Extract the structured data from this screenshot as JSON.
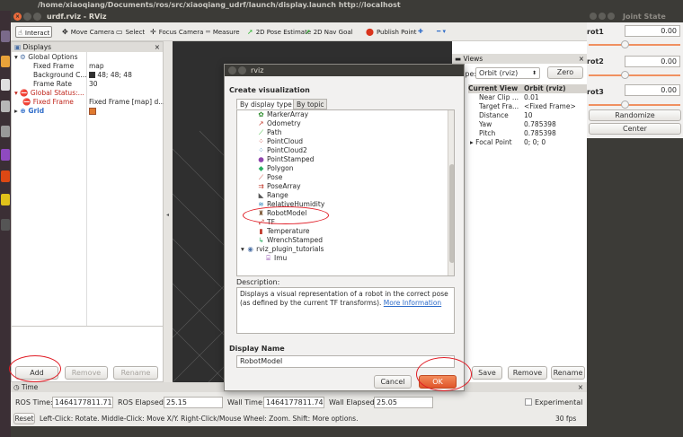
{
  "top_bar": {
    "title": "/home/xiaoqiang/Documents/ros/src/xiaoqiang_udrf/launch/display.launch http://localhost"
  },
  "rviz": {
    "title": "urdf.rviz - RViz",
    "toolbar": [
      {
        "label": "Interact",
        "icon": "hand-icon"
      },
      {
        "label": "Move Camera",
        "icon": "move-icon"
      },
      {
        "label": "Select",
        "icon": "select-icon"
      },
      {
        "label": "Focus Camera",
        "icon": "focus-icon"
      },
      {
        "label": "Measure",
        "icon": "ruler-icon"
      },
      {
        "label": "2D Pose Estimate",
        "icon": "arrow-green-icon"
      },
      {
        "label": "2D Nav Goal",
        "icon": "arrow-green-icon"
      },
      {
        "label": "Publish Point",
        "icon": "pin-icon"
      }
    ],
    "displays": {
      "title": "Displays",
      "rows": [
        {
          "name": "Global Options",
          "value": ""
        },
        {
          "name": "Fixed Frame",
          "value": "map"
        },
        {
          "name": "Background C...",
          "value": "48; 48; 48"
        },
        {
          "name": "Frame Rate",
          "value": "30"
        },
        {
          "name": "Global Status:...",
          "value": ""
        },
        {
          "name": "Fixed Frame",
          "value": "Fixed Frame [map] d..."
        },
        {
          "name": "Grid",
          "value": ""
        }
      ],
      "buttons": {
        "add": "Add",
        "remove": "Remove",
        "rename": "Rename"
      }
    },
    "views": {
      "title": "Views",
      "type_label": "Type:",
      "type_value": "Orbit (rviz)",
      "zero": "Zero",
      "header": [
        "Current View",
        "Orbit (rviz)"
      ],
      "rows": [
        {
          "k": "Near Clip ...",
          "v": "0.01"
        },
        {
          "k": "Target Fra...",
          "v": "<Fixed Frame>"
        },
        {
          "k": "Distance",
          "v": "10"
        },
        {
          "k": "Yaw",
          "v": "0.785398"
        },
        {
          "k": "Pitch",
          "v": "0.785398"
        },
        {
          "k": "Focal Point",
          "v": "0; 0; 0"
        }
      ],
      "buttons": {
        "save": "Save",
        "remove": "Remove",
        "rename": "Rename"
      }
    },
    "time": {
      "title": "Time",
      "ros_time_label": "ROS Time:",
      "ros_time": "1464177811.71",
      "ros_elapsed_label": "ROS Elapsed:",
      "ros_elapsed": "25.15",
      "wall_time_label": "Wall Time:",
      "wall_time": "1464177811.74",
      "wall_elapsed_label": "Wall Elapsed:",
      "wall_elapsed": "25.05",
      "experimental": "Experimental"
    },
    "status": {
      "reset": "Reset",
      "text": "Left-Click: Rotate. Middle-Click: Move X/Y. Right-Click/Mouse Wheel: Zoom. Shift: More options.",
      "fps": "30 fps"
    }
  },
  "dialog": {
    "title": "rviz",
    "heading": "Create visualization",
    "tabs": [
      "By display type",
      "By topic"
    ],
    "items": [
      {
        "label": "MarkerArray",
        "icon": "marker-icon",
        "color": "#2b8a2b"
      },
      {
        "label": "Odometry",
        "icon": "odometry-icon",
        "color": "#c0392b"
      },
      {
        "label": "Path",
        "icon": "path-icon",
        "color": "#2bb52b"
      },
      {
        "label": "PointCloud",
        "icon": "pointcloud-icon",
        "color": "#c0392b"
      },
      {
        "label": "PointCloud2",
        "icon": "pointcloud2-icon",
        "color": "#2980b9"
      },
      {
        "label": "PointStamped",
        "icon": "point-icon",
        "color": "#8e44ad"
      },
      {
        "label": "Polygon",
        "icon": "polygon-icon",
        "color": "#27ae60"
      },
      {
        "label": "Pose",
        "icon": "pose-icon",
        "color": "#c0392b"
      },
      {
        "label": "PoseArray",
        "icon": "posearray-icon",
        "color": "#c0392b"
      },
      {
        "label": "Range",
        "icon": "range-icon",
        "color": "#555555"
      },
      {
        "label": "RelativeHumidity",
        "icon": "humidity-icon",
        "color": "#2980b9"
      },
      {
        "label": "RobotModel",
        "icon": "robot-icon",
        "color": "#7f5b3a"
      },
      {
        "label": "TF",
        "icon": "tf-icon",
        "color": "#c0392b"
      },
      {
        "label": "Temperature",
        "icon": "temperature-icon",
        "color": "#c0392b"
      },
      {
        "label": "WrenchStamped",
        "icon": "wrench-icon",
        "color": "#27ae60"
      },
      {
        "label": "rviz_plugin_tutorials",
        "icon": "folder-icon",
        "color": "#4a6fa5"
      },
      {
        "label": "Imu",
        "icon": "imu-icon",
        "color": "#8e44ad"
      }
    ],
    "description_label": "Description:",
    "description": "Displays a visual representation of a robot in the correct pose (as defined by the current TF transforms).",
    "more_info": "More Information",
    "display_name_label": "Display Name",
    "display_name": "RobotModel",
    "cancel": "Cancel",
    "ok": "OK"
  },
  "joint_panel": {
    "title": "Joint State",
    "joints": [
      {
        "name": "rot1",
        "value": "0.00"
      },
      {
        "name": "rot2",
        "value": "0.00"
      },
      {
        "name": "rot3",
        "value": "0.00"
      }
    ],
    "randomize": "Randomize",
    "center": "Center"
  }
}
